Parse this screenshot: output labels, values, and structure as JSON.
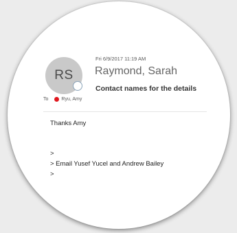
{
  "message": {
    "timestamp": "Fri 6/9/2017 11:19 AM",
    "sender_initials": "RS",
    "sender_name": "Raymond, Sarah",
    "subject": "Contact names for the details",
    "to_label": "To",
    "recipient": "Ryu, Amy",
    "recipient_status_color": "#e0161d",
    "body": {
      "line1": "Thanks Amy",
      "line2": ">",
      "line3": "> Email Yusef Yucel and Andrew Bailey",
      "line4": ">"
    }
  }
}
